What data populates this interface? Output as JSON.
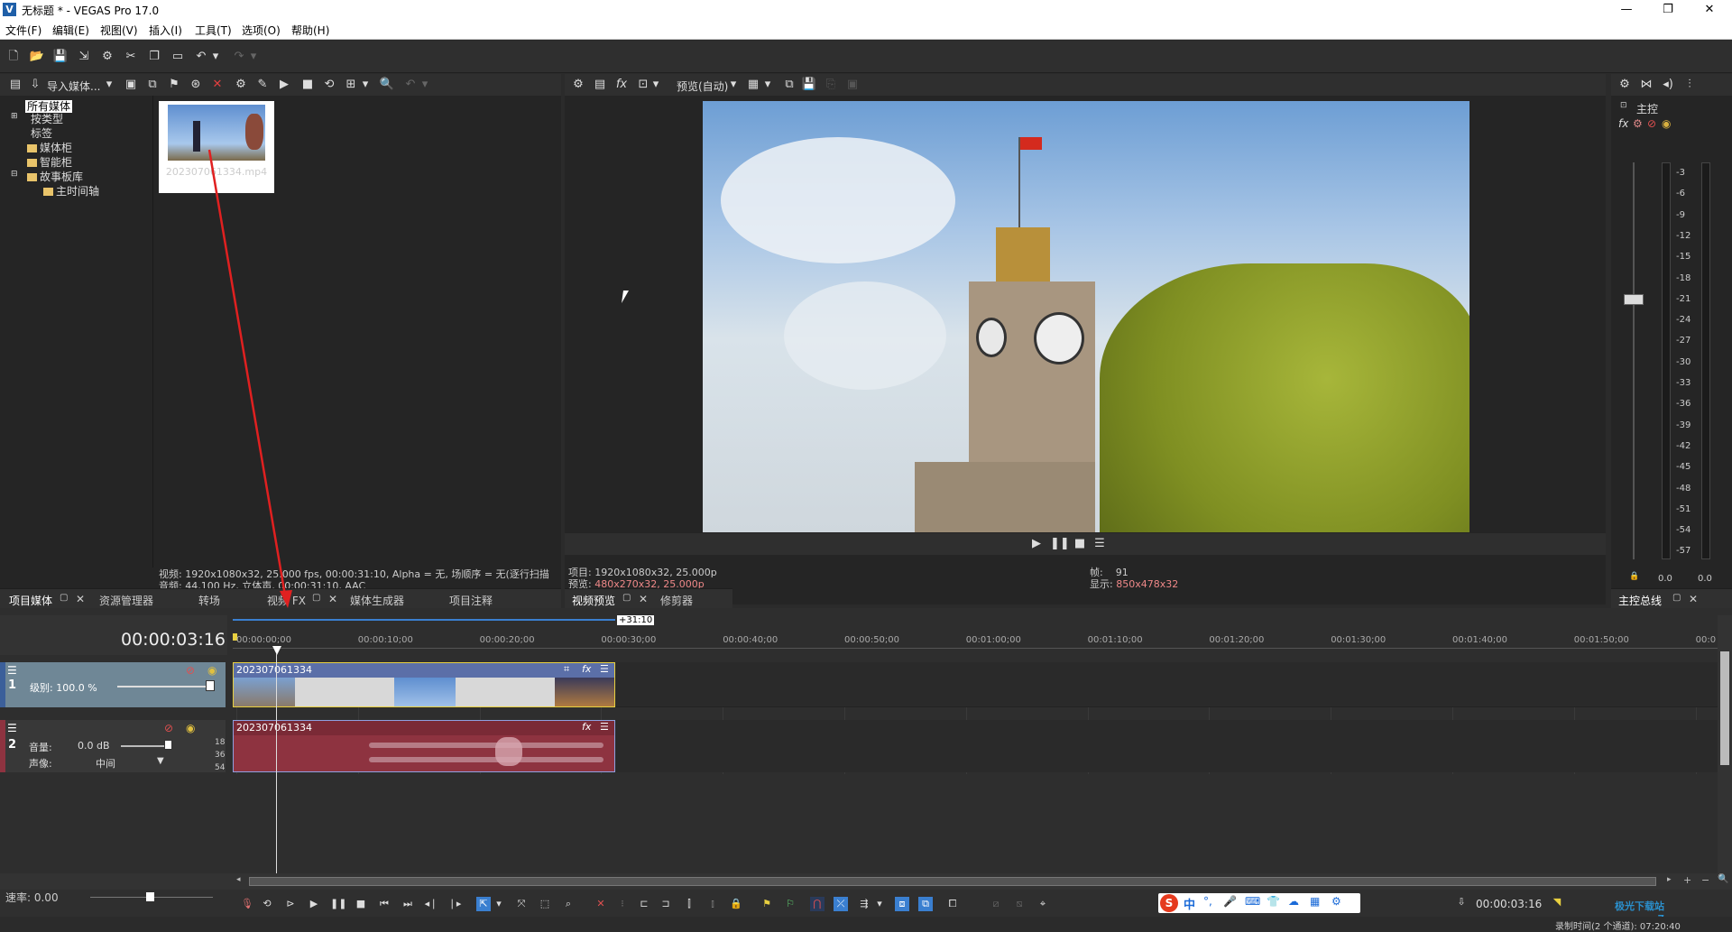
{
  "window": {
    "title": "无标题 * - VEGAS Pro 17.0",
    "logo": "V",
    "minimize": "—",
    "maximize": "❐",
    "close": "✕"
  },
  "menu": [
    "文件(F)",
    "编辑(E)",
    "视图(V)",
    "插入(I)",
    "工具(T)",
    "选项(O)",
    "帮助(H)"
  ],
  "media_panel": {
    "import_label": "导入媒体...",
    "tree": [
      "所有媒体",
      "按类型",
      "标签",
      "媒体柜",
      "智能柜",
      "故事板库",
      "主时间轴"
    ],
    "thumb_caption": "20230706​1334.mp4",
    "info_video": "视频: 1920x1080x32, 25.000 fps, 00:00:31:10, Alpha = 无, 场顺序 = 无(逐行扫描",
    "info_audio": "音频: 44,100 Hz, 立体声, 00:00:31:10, AAC",
    "tabs": [
      "项目媒体",
      "资源管理器",
      "转场",
      "视频 FX",
      "媒体生成器",
      "项目注释"
    ]
  },
  "preview": {
    "mode_label": "预览(自动)",
    "project_label": "项目:",
    "project_value": "1920x1080x32, 25.000p",
    "preview_label": "预览:",
    "preview_value": "480x270x32, 25.000p",
    "frame_label": "帧:",
    "frame_value": "91",
    "display_label": "显示:",
    "display_value": "850x478x32",
    "tabs": [
      "视频预览",
      "修剪器"
    ]
  },
  "master": {
    "label": "主控",
    "tab": "主控总线",
    "ticks": [
      "3",
      "6",
      "9",
      "12",
      "15",
      "18",
      "21",
      "24",
      "27",
      "30",
      "33",
      "36",
      "39",
      "42",
      "45",
      "48",
      "51",
      "54",
      "57"
    ],
    "left_value": "0.0",
    "right_value": "0.0"
  },
  "timeline": {
    "timecode": "00:00:03:16",
    "region_end": "+31:10",
    "ruler": [
      "00:00:00;00",
      "00:00:10;00",
      "00:00:20;00",
      "00:00:30;00",
      "00:00:40;00",
      "00:00:50;00",
      "00:01:00;00",
      "00:01:10;00",
      "00:01:20;00",
      "00:01:30;00",
      "00:01:40;00",
      "00:01:50;00",
      "00:0"
    ],
    "video_track": {
      "number": "1",
      "level_label": "级别: 100.0 %",
      "clip_name": "202307061334"
    },
    "audio_track": {
      "number": "2",
      "volume_label": "音量:",
      "volume_value": "0.0 dB",
      "pan_label": "声像:",
      "pan_value": "中间",
      "clip_name": "202307061334",
      "scale": [
        "18",
        "36",
        "54"
      ]
    },
    "rate_label": "速率: 0.00",
    "end_timecode": "00:00:03:16",
    "record_time": "录制时间(2 个通道): 07:20:40"
  },
  "ime": {
    "items": [
      "中",
      "°,",
      "🎤",
      "⌨",
      "👕",
      "☁",
      "▦",
      "⚙"
    ]
  },
  "watermark": "极光下载站 www.xz7.com",
  "colors": {
    "accent": "#3a7fd0",
    "video_clip": "#6f7fb7",
    "audio_clip": "#8e3340",
    "arrow": "#e02020"
  }
}
